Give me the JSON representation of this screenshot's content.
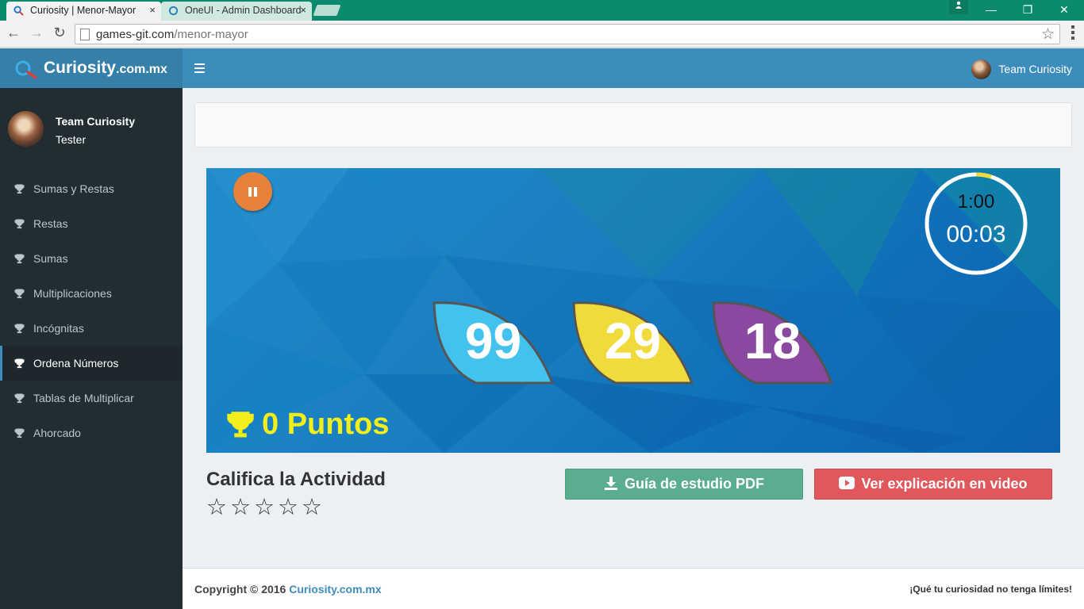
{
  "browser": {
    "tabs": [
      {
        "title": "Curiosity | Menor-Mayor",
        "active": true
      },
      {
        "title": "OneUI - Admin Dashboard",
        "active": false
      }
    ],
    "url_domain": "games-git.com",
    "url_path": "/menor-mayor",
    "close_glyph": "×",
    "minimize_glyph": "—",
    "restore_glyph": "❐",
    "window_close_glyph": "✕",
    "back_glyph": "←",
    "forward_glyph": "→",
    "reload_glyph": "↻",
    "bookmark_glyph": "☆"
  },
  "header": {
    "brand_main": "Curiosity",
    "brand_suffix": ".com.mx",
    "user_name": "Team Curiosity"
  },
  "sidebar": {
    "user_name": "Team Curiosity",
    "user_role": "Tester",
    "items": [
      {
        "label": "Sumas y Restas",
        "active": false
      },
      {
        "label": "Restas",
        "active": false
      },
      {
        "label": "Sumas",
        "active": false
      },
      {
        "label": "Multiplicaciones",
        "active": false
      },
      {
        "label": "Incógnitas",
        "active": false
      },
      {
        "label": "Ordena Números",
        "active": true
      },
      {
        "label": "Tablas de Multiplicar",
        "active": false
      },
      {
        "label": "Ahorcado",
        "active": false
      }
    ]
  },
  "game": {
    "timer_limit": "1:00",
    "timer_elapsed": "00:03",
    "timer_progress_fraction": 0.05,
    "numbers": [
      {
        "value": "99",
        "color": "#42c2ec"
      },
      {
        "value": "29",
        "color": "#f0da3c"
      },
      {
        "value": "18",
        "color": "#8a48a0"
      }
    ],
    "points_label": "0 Puntos",
    "pause_color": "#e8813a",
    "points_color": "#f2ee1a"
  },
  "rating": {
    "title": "Califica la Actividad",
    "stars": 5,
    "star_glyph": "☆"
  },
  "actions": {
    "pdf_label": "Guía de estudio PDF",
    "video_label": "Ver explicación en video"
  },
  "footer": {
    "copyright": "Copyright © 2016",
    "link": "Curiosity.com.mx",
    "tagline": "¡Qué tu curiosidad no tenga límites!"
  }
}
